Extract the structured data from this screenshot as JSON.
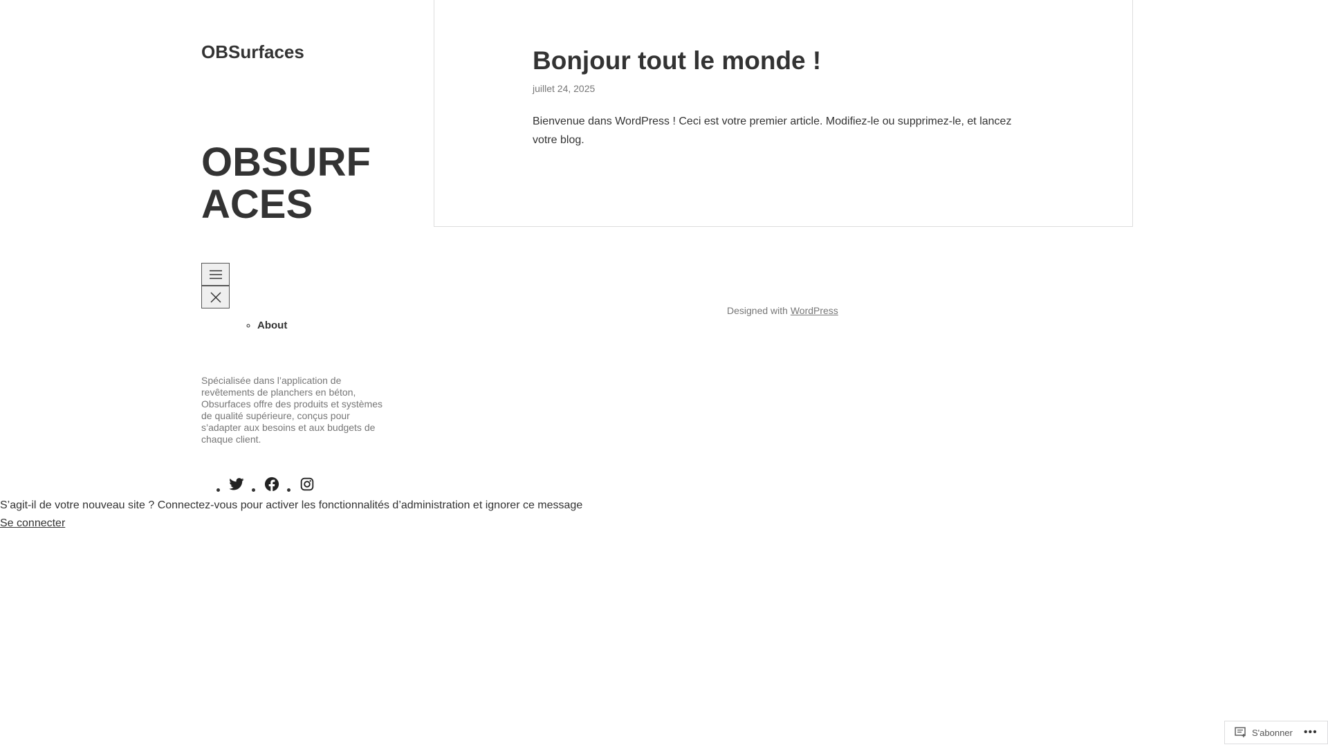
{
  "header": {
    "site_title": "OBSurfaces",
    "hero_title": "OBSURFACES"
  },
  "navigation": {
    "items": [
      {
        "label": "About"
      }
    ]
  },
  "sidebar": {
    "description": "Spécialisée dans l’application de revêtements de planchers en béton, Obsurfaces offre des produits et systèmes de qualité supérieure, conçus pour s’adapter aux besoins et aux budgets de chaque client.",
    "social_icons": [
      "twitter-icon",
      "facebook-icon",
      "instagram-icon"
    ]
  },
  "admin_notice": {
    "message": "S’agit-il de votre nouveau site ? Connectez-vous pour activer les fonctionnalités d’administration et ignorer ce message",
    "login_label": "Se connecter"
  },
  "post": {
    "title": "Bonjour tout le monde !",
    "date": "juillet 24, 2025",
    "body": "Bienvenue dans WordPress ! Ceci est votre premier article. Modifiez-le ou supprimez-le, et lancez votre blog."
  },
  "footer": {
    "credit_prefix": "Designed with",
    "credit_link": "WordPress"
  },
  "subscribe_bar": {
    "subscribe_label": "S'abonner",
    "more_label": "•••"
  }
}
